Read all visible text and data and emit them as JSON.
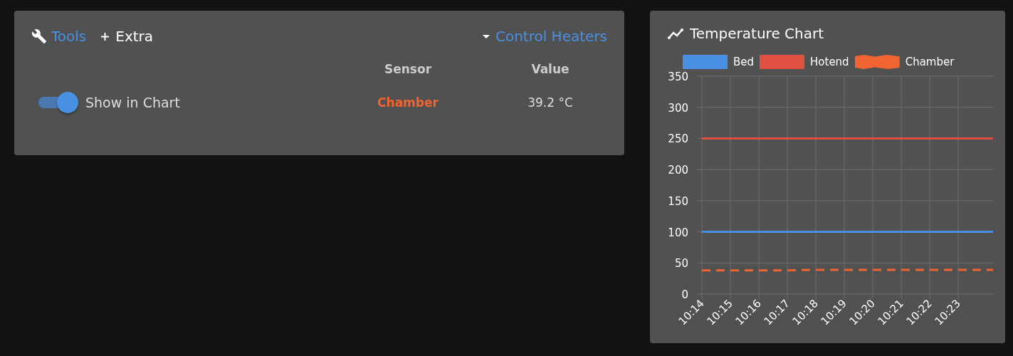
{
  "tools_panel": {
    "title": "Tools",
    "extra_button": "Extra",
    "control_heaters": "Control Heaters",
    "columns": [
      "Sensor",
      "Value"
    ],
    "rows": [
      {
        "toggle_label": "Show in Chart",
        "on": true,
        "sensor": "Chamber",
        "color": "#f06432",
        "value": "39.2 °C"
      }
    ]
  },
  "chart_panel": {
    "title": "Temperature Chart",
    "chart_data": {
      "type": "line",
      "x": [
        "10:14",
        "10:15",
        "10:16",
        "10:17",
        "10:18",
        "10:19",
        "10:20",
        "10:21",
        "10:22",
        "10:23"
      ],
      "ylim": [
        0,
        350
      ],
      "grid": true,
      "yticks": [
        0,
        50,
        100,
        150,
        200,
        250,
        300,
        350
      ],
      "series": [
        {
          "name": "Bed",
          "color": "#4a90e2",
          "line_style": "solid",
          "values": [
            100,
            100,
            100,
            100,
            100,
            100,
            100,
            100,
            100,
            100
          ]
        },
        {
          "name": "Hotend",
          "color": "#e05040",
          "line_style": "solid",
          "values": [
            250,
            250,
            250,
            250,
            250,
            250,
            250,
            250,
            250,
            250
          ]
        },
        {
          "name": "Chamber",
          "color": "#f06432",
          "line_style": "dashed",
          "values": [
            38,
            38,
            38,
            38,
            39,
            39,
            39,
            39,
            39,
            39
          ]
        }
      ]
    }
  }
}
